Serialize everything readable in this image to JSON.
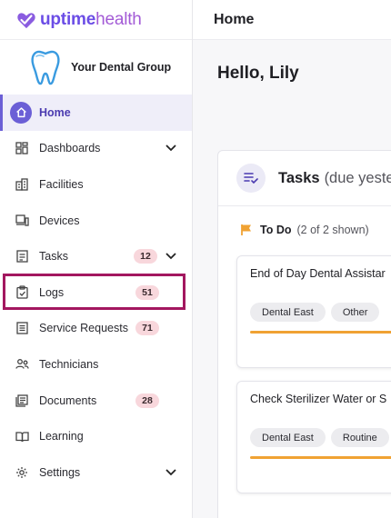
{
  "brand": {
    "part1": "uptime",
    "part2": "health"
  },
  "org": {
    "name": "Your Dental Group"
  },
  "header": {
    "title": "Home"
  },
  "sidebar": {
    "items": [
      {
        "label": "Home",
        "icon": "home-icon",
        "active": true
      },
      {
        "label": "Dashboards",
        "icon": "dashboard-icon",
        "expandable": true
      },
      {
        "label": "Facilities",
        "icon": "building-icon"
      },
      {
        "label": "Devices",
        "icon": "devices-icon"
      },
      {
        "label": "Tasks",
        "icon": "tasks-icon",
        "badge": "12",
        "expandable": true
      },
      {
        "label": "Logs",
        "icon": "clipboard-icon",
        "badge": "51",
        "highlighted": true
      },
      {
        "label": "Service Requests",
        "icon": "service-requests-icon",
        "badge": "71"
      },
      {
        "label": "Technicians",
        "icon": "technicians-icon"
      },
      {
        "label": "Documents",
        "icon": "documents-icon",
        "badge": "28"
      },
      {
        "label": "Learning",
        "icon": "learning-icon"
      },
      {
        "label": "Settings",
        "icon": "gear-icon",
        "expandable": true
      }
    ]
  },
  "main": {
    "greeting": "Hello, Lily",
    "tasks": {
      "title": "Tasks",
      "subtitle": "(due yeste",
      "todo": {
        "label": "To Do",
        "count": "(2 of 2 shown)"
      },
      "cards": [
        {
          "title": "End of Day Dental Assistar",
          "tags": [
            "Dental East",
            "Other"
          ],
          "progress": 1.0
        },
        {
          "title": "Check Sterilizer Water or S",
          "tags": [
            "Dental East",
            "Routine"
          ],
          "progress": 1.0
        }
      ]
    }
  },
  "colors": {
    "accent": "#6b5fd6",
    "highlight_border": "#a3175f",
    "badge_bg": "#f8d7dc",
    "progress": "#f0a233",
    "flag": "#f0a233"
  }
}
